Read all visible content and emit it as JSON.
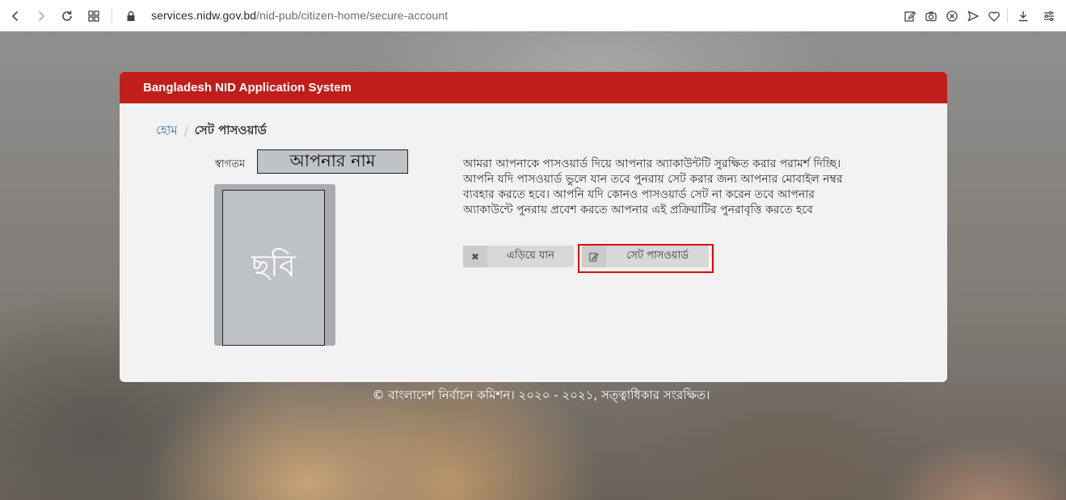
{
  "browser": {
    "url_host": "services.nidw.gov.bd",
    "url_path": "/nid-pub/citizen-home/secure-account"
  },
  "card": {
    "header_title": "Bangladesh NID Application System"
  },
  "breadcrumb": {
    "home": "হোম",
    "separator": "/",
    "current": "সেট পাসওয়ার্ড"
  },
  "profile": {
    "welcome_label": "স্বাগতম",
    "name_placeholder": "আপনার নাম",
    "photo_placeholder": "ছবি"
  },
  "message": "আমরা আপনাকে পাসওয়ার্ড দিয়ে আপনার অ্যাকাউন্টটি সুরক্ষিত করার পরামর্শ দিচ্ছি। আপনি যদি পাসওয়ার্ড ভুলে যান তবে পুনরায় সেট করার জন্য আপনার মোবাইল নম্বর ব্যবহার করতে হবে। আপনি যদি কোনও পাসওয়ার্ড সেট না করেন তবে আপনার অ্যাকাউন্টে পুনরায় প্রবেশ করতে আপনার এই প্রক্রিয়াটির পুনরাবৃত্তি করতে হবে",
  "actions": {
    "skip_label": "এড়িয়ে যান",
    "set_password_label": "সেট পাসওয়ার্ড"
  },
  "footer": "© বাংলাদেশ নির্বাচন কমিশন। ২০২০ - ২০২১, সত্ত্বাধিকার সংরক্ষিত।",
  "icons": {
    "skip": "close-icon",
    "set_password": "edit-icon"
  },
  "colors": {
    "header": "#c01e1b",
    "link": "#2a7ab0",
    "highlight": "#e00000"
  }
}
